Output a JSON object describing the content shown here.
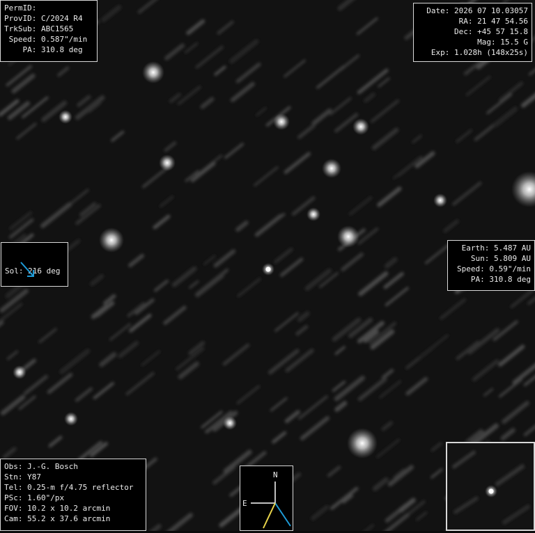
{
  "top_left": [
    {
      "label": "PermID:",
      "value": ""
    },
    {
      "label": "ProvID:",
      "value": "C/2024 R4"
    },
    {
      "label": "TrkSub:",
      "value": "ABC1565"
    },
    {
      "label": " Speed:",
      "value": "0.587\"/min"
    },
    {
      "label": "    PA:",
      "value": "310.8 deg"
    }
  ],
  "top_right": [
    {
      "label": "Date:",
      "value": "2026 07 10.03057"
    },
    {
      "label": "  RA:",
      "value": "21 47 54.56"
    },
    {
      "label": " Dec:",
      "value": "+45 57 15.8"
    },
    {
      "label": " Mag:",
      "value": "15.5 G"
    },
    {
      "label": " Exp:",
      "value": "1.028h (148x25s)"
    }
  ],
  "sol": {
    "label": "Sol:",
    "value": "216 deg"
  },
  "geometry": [
    {
      "label": "Earth:",
      "value": "5.487 AU"
    },
    {
      "label": "Sun:",
      "value": "5.809 AU"
    },
    {
      "label": "Speed:",
      "value": "0.59\"/min"
    },
    {
      "label": "PA:",
      "value": "310.8 deg"
    }
  ],
  "observer": [
    {
      "label": "Obs:",
      "value": "J.-G. Bosch"
    },
    {
      "label": "Stn:",
      "value": "Y87"
    },
    {
      "label": "Tel:",
      "value": "0.25-m f/4.75 reflector"
    },
    {
      "label": "PSc:",
      "value": "1.60\"/px"
    },
    {
      "label": "FOV:",
      "value": "10.2 x 10.2 arcmin"
    },
    {
      "label": "Cam:",
      "value": "55.2 x 37.6 arcmin"
    }
  ],
  "compass": {
    "north": "N",
    "east": "E"
  },
  "colors": {
    "sun_arrow": "#1e9bd7",
    "motion_arrow": "#e8d44a",
    "frame": "#d9d9d9"
  }
}
